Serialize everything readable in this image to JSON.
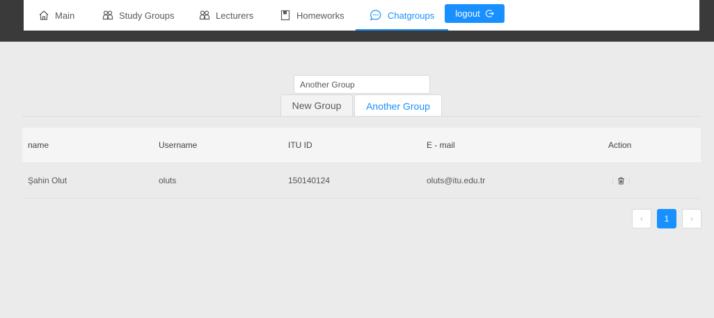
{
  "nav": {
    "items": [
      {
        "label": "Main",
        "icon": "home-icon"
      },
      {
        "label": "Study Groups",
        "icon": "groups-icon"
      },
      {
        "label": "Lecturers",
        "icon": "groups-icon"
      },
      {
        "label": "Homeworks",
        "icon": "book-icon"
      },
      {
        "label": "Chatgroups",
        "icon": "chat-icon",
        "active": true
      }
    ],
    "logout_label": "logout"
  },
  "group_selector": {
    "value": "Another Group"
  },
  "tabs": [
    {
      "label": "New Group",
      "active": false
    },
    {
      "label": "Another Group",
      "active": true
    }
  ],
  "table": {
    "columns": [
      "name",
      "Username",
      "ITU ID",
      "E - mail",
      "Action"
    ],
    "rows": [
      {
        "name": "Şahin Olut",
        "username": "oluts",
        "itu_id": "150140124",
        "email": "oluts@itu.edu.tr"
      }
    ]
  },
  "pagination": {
    "current": "1",
    "prev": "‹",
    "next": "›"
  },
  "colors": {
    "accent": "#1890ff",
    "topbar": "#3a3a3a",
    "background": "#ebebeb"
  }
}
